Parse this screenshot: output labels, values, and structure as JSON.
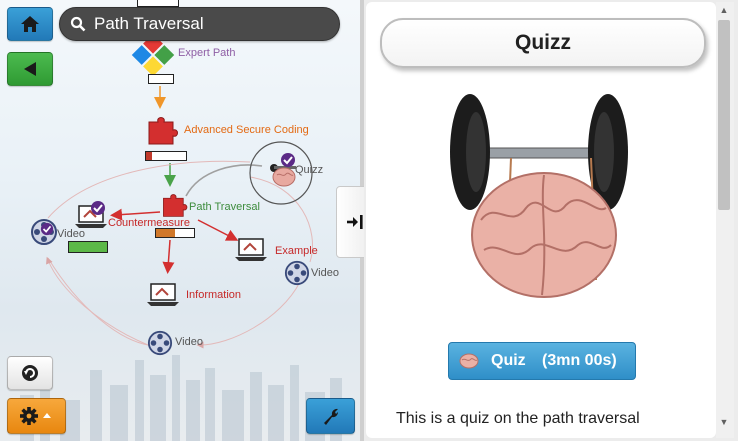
{
  "search": {
    "query": "Path Traversal"
  },
  "graph": {
    "nodes": {
      "expert_path": "Expert Path",
      "advanced_secure_coding": "Advanced Secure Coding",
      "quizz": "Quizz",
      "path_traversal": "Path Traversal",
      "countermeasure": "Countermeasure",
      "example": "Example",
      "information": "Information",
      "video_left": "Video",
      "video_right": "Video",
      "video_bottom": "Video"
    },
    "progress": {
      "expert_path": 0.0,
      "advanced_secure_coding": 0.15,
      "path_traversal": 0.5,
      "video_left": 1.0
    }
  },
  "panel": {
    "title": "Quizz",
    "quiz_button_label": "Quiz",
    "quiz_button_duration": "(3mn 00s)",
    "description": "This is a quiz on the path traversal"
  },
  "icons": [
    "home-icon",
    "back-arrow-icon",
    "search-icon",
    "puzzle-icon",
    "laptop-icon",
    "film-reel-icon",
    "brain-icon",
    "checkmark-badge-icon",
    "refresh-icon",
    "gear-icon",
    "caret-up-icon",
    "wrench-icon",
    "collapse-panel-icon",
    "dumbbell-brain-image"
  ],
  "colors": {
    "expert_label": "#8e5ea5",
    "advanced_label": "#e36a14",
    "path_label": "#3d8c3d",
    "red_label": "#c62828",
    "gray_label": "#555555",
    "progress_fill_red": "#c0392b",
    "progress_fill_orange": "#d0782a",
    "progress_fill_green": "#5cb848",
    "accent_blue": "#2f8fc8"
  }
}
